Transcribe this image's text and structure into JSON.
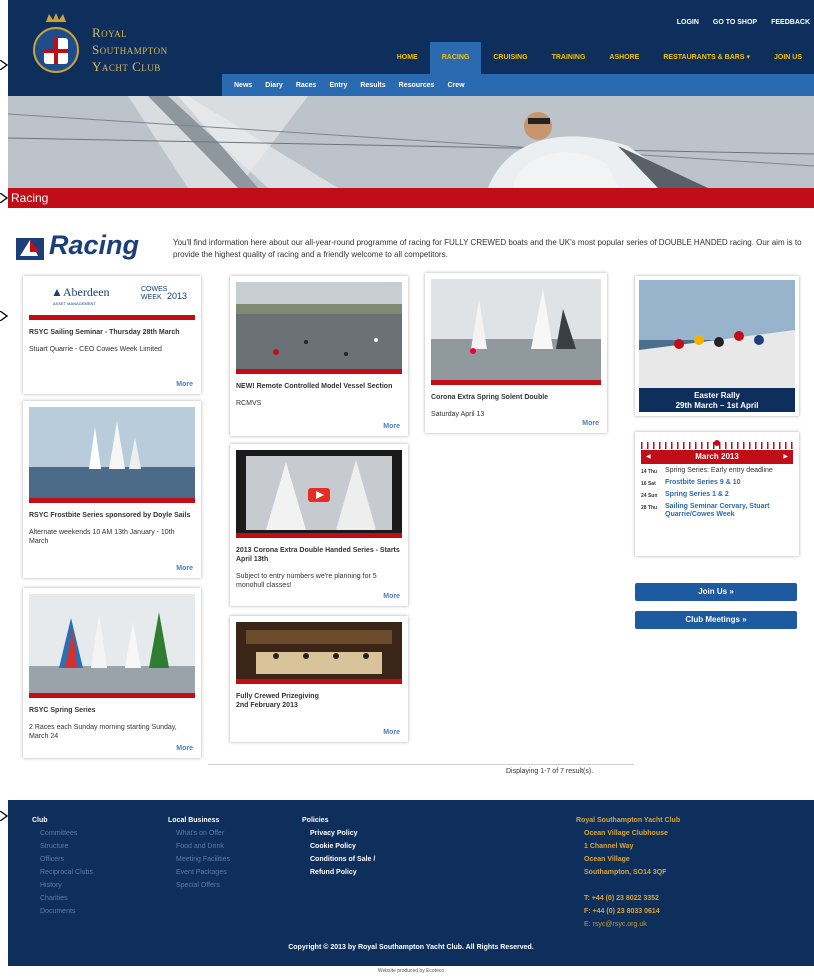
{
  "club": {
    "line1": "Royal",
    "line2": "Southampton",
    "line3": "Yacht Club"
  },
  "top_nav": [
    "LOGIN",
    "GO TO SHOP",
    "FEEDBACK"
  ],
  "main_nav": [
    {
      "label": "HOME",
      "active": false
    },
    {
      "label": "RACING",
      "active": true
    },
    {
      "label": "CRUISING",
      "active": false
    },
    {
      "label": "TRAINING",
      "active": false
    },
    {
      "label": "ASHORE",
      "active": false
    },
    {
      "label": "RESTAURANTS & BARS",
      "active": false
    },
    {
      "label": "JOIN US",
      "active": false
    }
  ],
  "sub_nav": [
    "News",
    "Diary",
    "Races",
    "Entry",
    "Results",
    "Resources",
    "Crew"
  ],
  "page_title": "Racing",
  "racing_logo": {
    "prefix": "RSYC",
    "word": "Racing"
  },
  "intro": "You'll find information here about our all-year-round programme of racing for FULLY CREWED boats and the UK's most popular series of DOUBLE HANDED racing. Our aim is to provide the highest quality of racing and a friendly welcome to all competitors.",
  "cards": {
    "c1": {
      "logo_left": "Aberdeen",
      "logo_sub": "ASSET MANAGEMENT",
      "logo_right": "COWES WEEK",
      "logo_year": "2013",
      "title": "RSYC Sailing Seminar - Thursday 28th March",
      "text": "Stuart Quarrie - CEO Cowes Week Limited",
      "more": "More"
    },
    "c2": {
      "title": "NEW! Remote Controlled Model Vessel Section",
      "text": "RCMVS",
      "more": "More"
    },
    "c3": {
      "title": "Corona Extra Spring Solent Double",
      "text": "Saturday April 13",
      "more": "More"
    },
    "c4": {
      "title": "RSYC Frostbite Series sponsored by Doyle Sails",
      "text": "Alternate weekends 10 AM 13th January - 10th March",
      "more": "More"
    },
    "c5": {
      "title": "2013 Corona Extra Double Handed Series - Starts April 13th",
      "text": "Subject to entry numbers we're planning for 5 monohull classes!",
      "more": "More"
    },
    "c6": {
      "title": "RSYC Spring Series",
      "text": "2 Races each Sunday morning starting Sunday, March 24",
      "more": "More"
    },
    "c7": {
      "title": "Fully Crewed Prizegiving",
      "text": "2nd February 2013",
      "more": "More"
    }
  },
  "easter": {
    "line1": "Easter Rally",
    "line2": "29th March – 1st April"
  },
  "calendar": {
    "month": "March 2013",
    "events": [
      {
        "day": "14 Thu",
        "text": "Spring Series: Early entry deadline",
        "link": false
      },
      {
        "day": "16 Sat",
        "text": "Frostbite Series 9 & 10",
        "link": true
      },
      {
        "day": "24 Sun",
        "text": "Spring Series 1 & 2",
        "link": true
      },
      {
        "day": "28 Thu",
        "text": "Sailing Seminar Corvary, Stuart Quarrie/Cowes Week",
        "link": true
      }
    ]
  },
  "buttons": {
    "join": "Join Us »",
    "meetings": "Club Meetings »"
  },
  "results_text": "Displaying 1-7 of 7 result(s).",
  "footer": {
    "club": {
      "heading": "Club",
      "items": [
        "Committees",
        "Structure",
        "Officers",
        "Reciprocal Clubs",
        "History",
        "Charities",
        "Documents"
      ]
    },
    "local": {
      "heading": "Local Business",
      "items": [
        "What's on Offer",
        "Food and Drink",
        "Meeting Facilities",
        "Event Packages",
        "Special Offers"
      ]
    },
    "policies": {
      "heading": "Policies",
      "items": [
        "Privacy Policy",
        "Cookie Policy",
        "Conditions of Sale /",
        "Refund Policy"
      ]
    },
    "address": {
      "heading": "Royal Southampton Yacht Club",
      "lines": [
        "Ocean Village Clubhouse",
        "1 Channel Way",
        "Ocean Village",
        "Southampton, SO14 3QF"
      ],
      "tel": "T: +44 (0) 23 8022 3352",
      "fax": "F: +44 (0) 23 8033 0614",
      "email": "E: rsyc@rsyc.org.uk"
    },
    "copyright": "Copyright © 2013 by Royal Southampton Yacht Club. All Rights Reserved."
  },
  "producer": "Website produced by Ecoteco"
}
